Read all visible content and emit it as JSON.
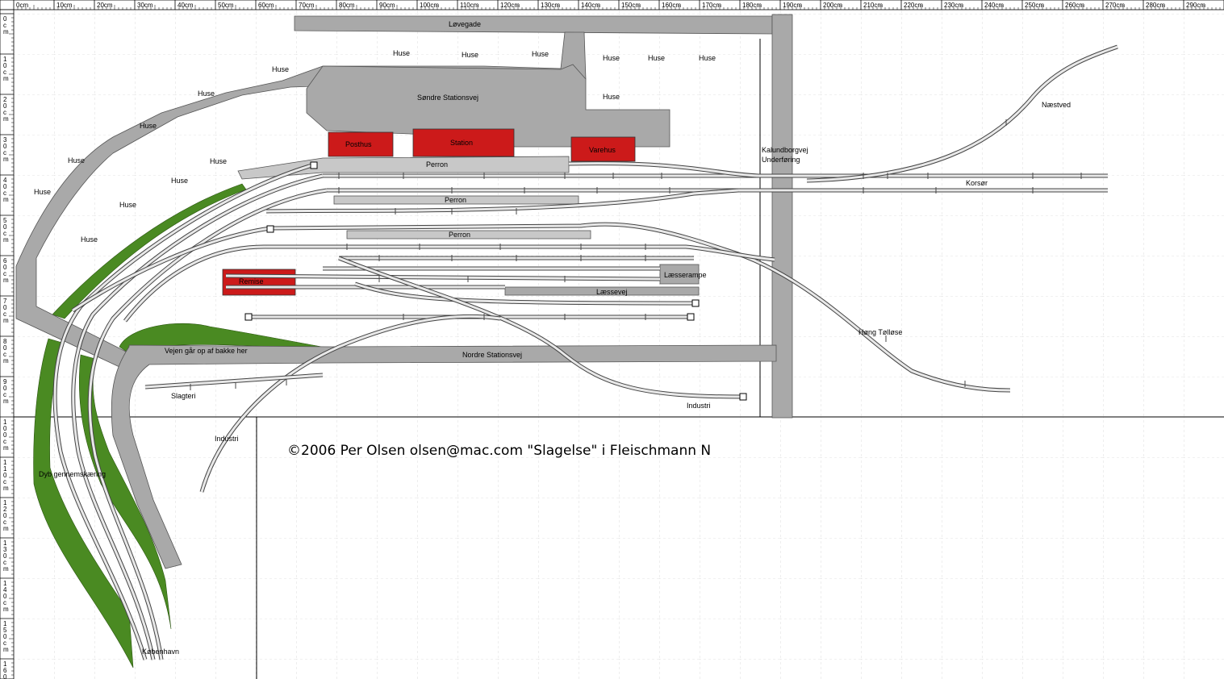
{
  "ruler": {
    "top_labels": [
      "0cm",
      "10cm",
      "20cm",
      "30cm",
      "40cm",
      "50cm",
      "60cm",
      "70cm",
      "80cm",
      "90cm",
      "100cm",
      "110cm",
      "120cm",
      "130cm",
      "140cm",
      "150cm",
      "160cm",
      "170cm",
      "180cm",
      "190cm",
      "200cm",
      "210cm",
      "220cm",
      "230cm",
      "240cm",
      "250cm",
      "260cm",
      "270cm",
      "280cm",
      "290cm"
    ],
    "left_labels": [
      "0",
      "10",
      "20",
      "30",
      "40",
      "50",
      "60",
      "70",
      "80",
      "90",
      "100",
      "110",
      "120",
      "130",
      "140",
      "150",
      "160"
    ]
  },
  "labels": {
    "lovegade": "Løvegade",
    "sondre_stationsvej": "Søndre Stationsvej",
    "nordre_stationsvej": "Nordre Stationsvej",
    "vejen": "Vejen går op af bakke her",
    "posthus": "Posthus",
    "station": "Station",
    "varehus": "Varehus",
    "remise": "Remise",
    "perron1": "Perron",
    "perron2": "Perron",
    "perron3": "Perron",
    "laesserampe": "Læsserampe",
    "laessevej": "Læssevej",
    "kalundborgvej": "Kalundborgvej",
    "underforing": "Underføring",
    "korsor": "Korsør",
    "naestved": "Næstved",
    "hong_tollose": "Høng Tølløse",
    "industri1": "Industri",
    "industri2": "Industri",
    "slagteri": "Slagteri",
    "dyb": "Dyb gennemskæring",
    "kobenhavn": "København",
    "copyright": "©2006 Per Olsen  olsen@mac.com  \"Slagelse\" i Fleischmann N"
  },
  "huse_label": "Huse",
  "colors": {
    "road": "#a9a9a9",
    "building": "#cc1a1a",
    "platform": "#c8c8c8",
    "embankment": "#4a8a22",
    "grid": "#c8c8c8"
  }
}
